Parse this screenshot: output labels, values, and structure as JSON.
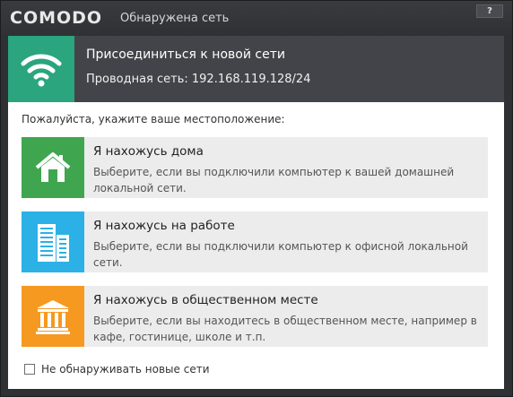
{
  "window": {
    "brand": "COMODO",
    "title": "Обнаружена сеть",
    "help_label": "?"
  },
  "header": {
    "title": "Присоединиться к новой сети",
    "subtitle": "Проводная сеть: 192.168.119.128/24",
    "icon": "wifi-icon"
  },
  "prompt": "Пожалуйста, укажите ваше местоположение:",
  "options": [
    {
      "title": "Я нахожусь дома",
      "description": "Выберите, если вы подключили компьютер к вашей домашней локальной сети.",
      "icon": "home-icon",
      "color": "#3fa64f"
    },
    {
      "title": "Я нахожусь на работе",
      "description": "Выберите, если вы подключили компьютер к офисной локальной сети.",
      "icon": "office-buildings-icon",
      "color": "#2bb1e6"
    },
    {
      "title": "Я нахожусь в общественном месте",
      "description": "Выберите, если вы находитесь в общественном месте, например в кафе, гостинице, школе и т.п.",
      "icon": "public-building-icon",
      "color": "#f69920"
    }
  ],
  "dont_detect": {
    "label": "Не обнаруживать новые сети",
    "checked": false
  },
  "colors": {
    "header_accent": "#2aa57d",
    "titlebar": "#3a3b3f"
  }
}
